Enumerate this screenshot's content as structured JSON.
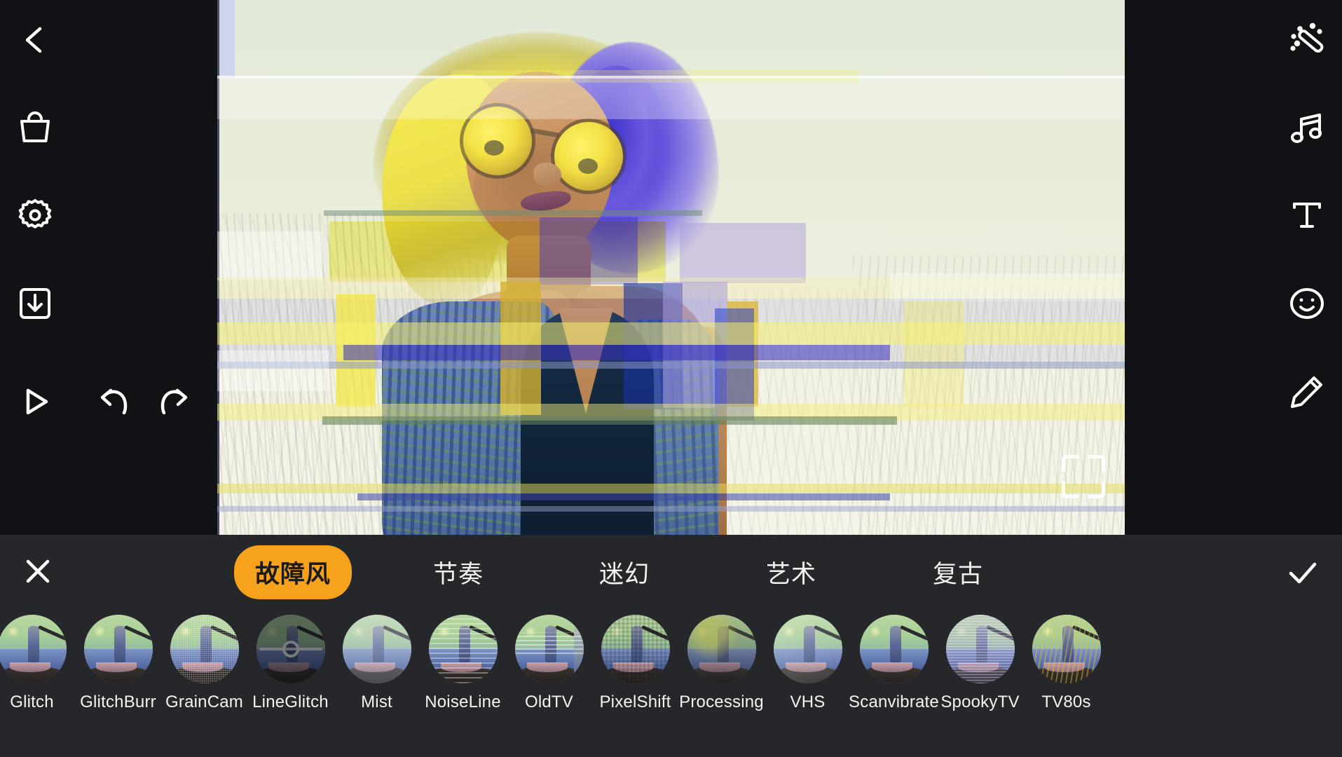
{
  "app": {
    "title": "Video Filter Editor",
    "accent_color": "#f6a21c",
    "panel_bg": "#26272b",
    "editor_bg": "#111216"
  },
  "left_rail": {
    "items": [
      {
        "name": "back-button",
        "icon": "chevron-left-icon",
        "label": "Back"
      },
      {
        "name": "shop-button",
        "icon": "shopping-bag-icon",
        "label": "Store"
      },
      {
        "name": "settings-button",
        "icon": "gear-icon",
        "label": "Settings"
      },
      {
        "name": "export-button",
        "icon": "download-icon",
        "label": "Export"
      }
    ]
  },
  "transport": {
    "play": {
      "icon": "play-icon",
      "label": "Play"
    },
    "undo": {
      "icon": "undo-arrow-icon",
      "label": "Undo"
    },
    "redo": {
      "icon": "redo-arrow-icon",
      "label": "Redo"
    }
  },
  "right_rail": {
    "items": [
      {
        "name": "magic-button",
        "icon": "magic-wand-icon",
        "label": "Effects"
      },
      {
        "name": "music-button",
        "icon": "music-note-icon",
        "label": "Music"
      },
      {
        "name": "text-button",
        "icon": "text-t-icon",
        "label": "Text"
      },
      {
        "name": "sticker-button",
        "icon": "smiley-icon",
        "label": "Sticker"
      },
      {
        "name": "draw-button",
        "icon": "pencil-icon",
        "label": "Draw"
      }
    ]
  },
  "preview": {
    "expand_icon": "fullscreen-brackets-icon",
    "colors": {
      "background": "#dfe8d9",
      "glitch_yellow": "#f5e64a",
      "glitch_blue": "#4536cf",
      "glitch_purple": "#9b90e4",
      "lavender_strip": "#ccd5ec",
      "dress_navy": "#12253c",
      "skin": "#c9925f"
    }
  },
  "panel": {
    "close_icon": "close-x-icon",
    "confirm_icon": "checkmark-icon",
    "tabs": [
      {
        "label": "故障风",
        "active": true
      },
      {
        "label": "节奏",
        "active": false
      },
      {
        "label": "迷幻",
        "active": false
      },
      {
        "label": "艺术",
        "active": false
      },
      {
        "label": "复古",
        "active": false
      }
    ],
    "filters": [
      {
        "label": "Glitch",
        "variant": "v-base",
        "slider": false
      },
      {
        "label": "GlitchBurr",
        "variant": "v-base",
        "slider": false
      },
      {
        "label": "GrainCam",
        "variant": "v-grain",
        "slider": false
      },
      {
        "label": "LineGlitch",
        "variant": "v-dark",
        "slider": true
      },
      {
        "label": "Mist",
        "variant": "v-mist",
        "slider": false
      },
      {
        "label": "NoiseLine",
        "variant": "v-scan",
        "slider": false
      },
      {
        "label": "OldTV",
        "variant": "v-oldtv",
        "slider": false
      },
      {
        "label": "PixelShift",
        "variant": "v-pixel",
        "slider": false
      },
      {
        "label": "Processing",
        "variant": "v-proc",
        "slider": false
      },
      {
        "label": "VHS",
        "variant": "v-vhs",
        "slider": false
      },
      {
        "label": "Scanvibrate",
        "variant": "v-base",
        "slider": false
      },
      {
        "label": "SpookyTV",
        "variant": "v-spooky",
        "slider": false
      },
      {
        "label": "TV80s",
        "variant": "v-tv80",
        "slider": false
      }
    ]
  }
}
